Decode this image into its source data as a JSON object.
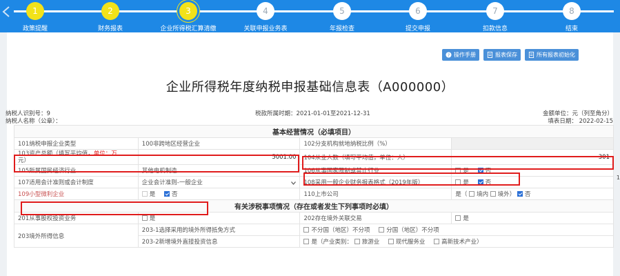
{
  "steps": [
    {
      "num": "1",
      "label": "政策提醒"
    },
    {
      "num": "2",
      "label": "财务报表"
    },
    {
      "num": "3",
      "label": "企业所得税汇算清缴"
    },
    {
      "num": "4",
      "label": "关联申报业务表"
    },
    {
      "num": "5",
      "label": "年报检查"
    },
    {
      "num": "6",
      "label": "提交申报"
    },
    {
      "num": "7",
      "label": "扣款信息"
    },
    {
      "num": "8",
      "label": "结束"
    }
  ],
  "colors": {
    "header": "#1e88e5",
    "step_done": "#f2e21a",
    "highlight": "#e01b1b",
    "accent": "#2a6fd6"
  },
  "toolbar": {
    "manual": "操作手册",
    "save": "报表保存",
    "init": "所有报表初始化"
  },
  "title": "企业所得税年度纳税申报基础信息表（A000000）",
  "meta": {
    "taxpayer_id": "纳税人识别号：9",
    "taxpayer_name": "纳税人名称（公章）：",
    "period": "税款所属时期：2021-01-01至2021-12-31",
    "unit": "金额单位：元（列至角分）",
    "fill_date": "填表日期： 2022-02-15"
  },
  "sections": {
    "basic": "基本经营情况（必填项目）",
    "tax": "有关涉税事项情况（存在或者发生下列事项时必填）"
  },
  "rows": {
    "r101_label": "101纳税申报企业类型",
    "r101_value": "100非跨地区经营企业",
    "r102_label": "102分支机构就地纳税比例（%）",
    "r103_label": "103资产总额（填写平均值，",
    "r103_unit": "单位：万",
    "r103_unit2": "元）",
    "r103_value": "5001.00",
    "r104_label": "104从业人数（填写平均值，单位：人）",
    "r104_value": "301",
    "r105_label": "105所属国民经济行业",
    "r105_value": "其他电机制造",
    "r106_label": "106从事国家限制或禁止行业",
    "r107_label": "107适用会计准则或会计制度",
    "r107_value": "企业会计准则-一般企业",
    "r108_label": "108采用一般企业财务报表格式（2019年版）",
    "r109_label": "109小型微利企业",
    "r110_label": "110上市公司",
    "r110_yes": "是（",
    "r110_in": "境内",
    "r110_out": "境外）",
    "r110_no": "否",
    "r201_label": "201从事股权投资业务",
    "r202_label": "202存在境外关联交易",
    "r203_label": "203境外所得信息",
    "r203_1_label": "203-1选择采用的境外所得抵免方式",
    "r203_1_opt1": "不分国（地区）不分项",
    "r203_1_opt2": "分国（地区）不分项",
    "r203_2_label": "203-2新增境外直接投资信息",
    "r203_2_yes": "是（产业类别：",
    "r203_2_c1": "旅游业",
    "r203_2_c2": "现代服务业",
    "r203_2_c3": "高新技术产业）"
  },
  "options": {
    "yes": "是",
    "no": "否"
  },
  "side_text": "1"
}
